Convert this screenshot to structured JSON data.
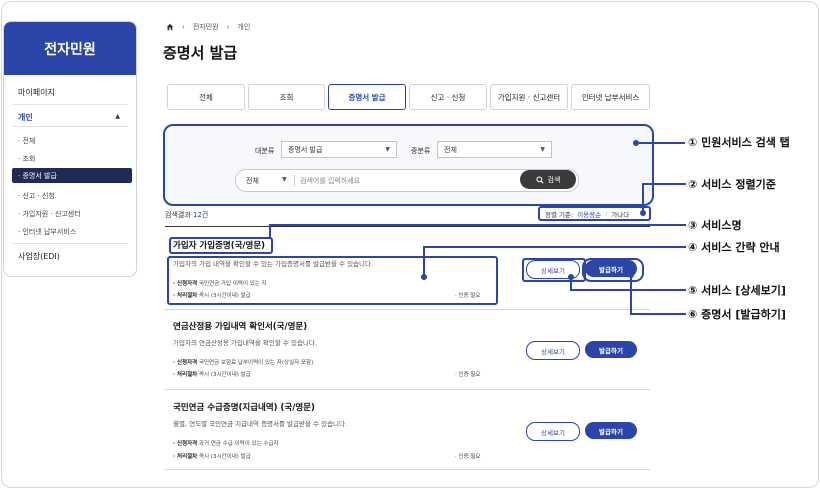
{
  "sidebar": {
    "title": "전자민원",
    "mypage": "마이페이지",
    "section": "개인",
    "items": [
      "· 전체",
      "· 조회",
      "· 증명서 발급",
      "· 신고 · 신청",
      "· 가입지원 · 신고센터",
      "· 인터넷 납부서비스"
    ],
    "corporate": "사업장(EDI)"
  },
  "breadcrumb": [
    "전자민원",
    "개인"
  ],
  "page_title": "증명서 발급",
  "tabs": [
    "전체",
    "조회",
    "증명서 발급",
    "신고 · 신청",
    "가입지원 · 신고센터",
    "인터넷 납부서비스"
  ],
  "search": {
    "major_label": "대분류",
    "major_value": "증명서 발급",
    "middle_label": "중분류",
    "middle_value": "전체",
    "scope": "전체",
    "placeholder": "검색어를 입력하세요",
    "button": "검색"
  },
  "results": {
    "prefix": "검색결과 ",
    "count": "12건",
    "sort_label": "정렬 기준:",
    "sort_option1": "이용량순",
    "sort_option2": "가나다"
  },
  "services": [
    {
      "name": "가입자 가입증명(국/영문)",
      "desc": "가입자의 가입 내역을 확인할 수 있는 가입증명서를 발급받을 수 있습니다.",
      "qual_label": "· 신청자격",
      "qual": "국민연금 가입 이력이 있는 자",
      "proc_label": "· 처리절차",
      "proc": "즉시 (3시간이내) 발급",
      "cert": "· 인증 필요"
    },
    {
      "name": "연금산정용 가입내역 확인서(국/영문)",
      "desc": "가입자의 연금산정용 가입내역을 확인할 수 있습니다.",
      "qual_label": "· 신청자격",
      "qual": "국민연금 보험료 납부이력이 있는 자(상실자 포함)",
      "proc_label": "· 처리절차",
      "proc": "즉시 (3시간이내) 발급",
      "cert": "· 인증 필요"
    },
    {
      "name": "국민연금 수급증명(지급내역) (국/영문)",
      "desc": "월별, 연도별 국민연금 지급내역 증명서를 발급받을 수 있습니다.",
      "qual_label": "· 신청자격",
      "qual": "과거 연금 수급 이력이 있는 수급자",
      "proc_label": "· 처리절차",
      "proc": "즉시 (3시간이내) 발급",
      "cert": "· 인증 필요"
    }
  ],
  "buttons": {
    "detail": "상세보기",
    "issue": "발급하기"
  },
  "callouts": [
    "① 민원서비스 검색 탭",
    "② 서비스 정렬기준",
    "③ 서비스명",
    "④ 서비스 간략 안내",
    "⑤ 서비스 [상세보기]",
    "⑥ 증명서 [발급하기]"
  ],
  "colors": {
    "accent": "#2b46a8",
    "active_menu": "#202a55",
    "search_button": "#3a3a3a"
  }
}
